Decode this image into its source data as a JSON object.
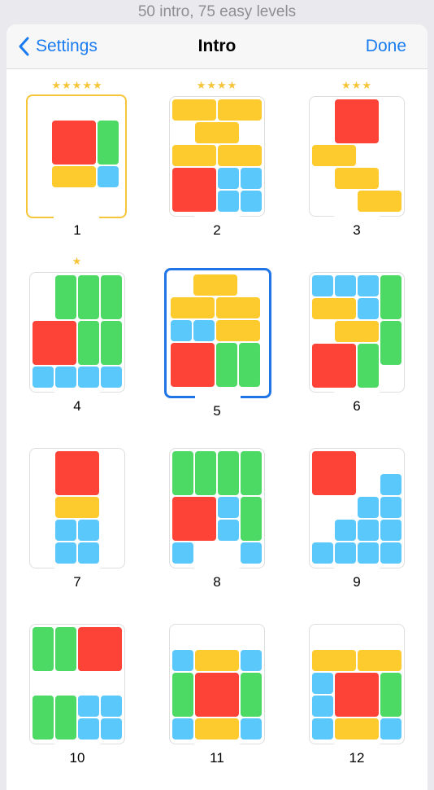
{
  "caption": "50 intro, 75 easy levels",
  "nav": {
    "back_label": "Settings",
    "title": "Intro",
    "done_label": "Done"
  },
  "icons": {
    "back": "chevron-left-icon",
    "star": "star-icon"
  },
  "colors": {
    "accent": "#1a7cf0",
    "star": "#f7c53a",
    "red": "#fd4237",
    "yellow": "#fecb2e",
    "green": "#4cd964",
    "blue": "#5ac8fa"
  },
  "levels": [
    {
      "number": "1",
      "stars": 5,
      "selected": "gold",
      "pieces": [
        {
          "c": "red",
          "x": 1,
          "y": 1,
          "w": 2,
          "h": 2
        },
        {
          "c": "green",
          "x": 3,
          "y": 1,
          "w": 1,
          "h": 2
        },
        {
          "c": "yellow",
          "x": 1,
          "y": 3,
          "w": 2,
          "h": 1
        },
        {
          "c": "blue",
          "x": 3,
          "y": 3,
          "w": 1,
          "h": 1
        }
      ]
    },
    {
      "number": "2",
      "stars": 4,
      "selected": "",
      "pieces": [
        {
          "c": "yellow",
          "x": 0,
          "y": 0,
          "w": 2,
          "h": 1
        },
        {
          "c": "yellow",
          "x": 2,
          "y": 0,
          "w": 2,
          "h": 1
        },
        {
          "c": "yellow",
          "x": 1,
          "y": 1,
          "w": 2,
          "h": 1
        },
        {
          "c": "yellow",
          "x": 0,
          "y": 2,
          "w": 2,
          "h": 1
        },
        {
          "c": "yellow",
          "x": 2,
          "y": 2,
          "w": 2,
          "h": 1
        },
        {
          "c": "red",
          "x": 0,
          "y": 3,
          "w": 2,
          "h": 2
        },
        {
          "c": "blue",
          "x": 2,
          "y": 3,
          "w": 1,
          "h": 1
        },
        {
          "c": "blue",
          "x": 3,
          "y": 3,
          "w": 1,
          "h": 1
        },
        {
          "c": "blue",
          "x": 2,
          "y": 4,
          "w": 1,
          "h": 1
        },
        {
          "c": "blue",
          "x": 3,
          "y": 4,
          "w": 1,
          "h": 1
        }
      ]
    },
    {
      "number": "3",
      "stars": 3,
      "selected": "",
      "pieces": [
        {
          "c": "red",
          "x": 1,
          "y": 0,
          "w": 2,
          "h": 2
        },
        {
          "c": "yellow",
          "x": 0,
          "y": 2,
          "w": 2,
          "h": 1
        },
        {
          "c": "yellow",
          "x": 1,
          "y": 3,
          "w": 2,
          "h": 1
        },
        {
          "c": "yellow",
          "x": 2,
          "y": 4,
          "w": 2,
          "h": 1
        }
      ]
    },
    {
      "number": "4",
      "stars": 1,
      "selected": "",
      "pieces": [
        {
          "c": "green",
          "x": 1,
          "y": 0,
          "w": 1,
          "h": 2
        },
        {
          "c": "green",
          "x": 2,
          "y": 0,
          "w": 1,
          "h": 2
        },
        {
          "c": "green",
          "x": 3,
          "y": 0,
          "w": 1,
          "h": 2
        },
        {
          "c": "red",
          "x": 0,
          "y": 2,
          "w": 2,
          "h": 2
        },
        {
          "c": "green",
          "x": 2,
          "y": 2,
          "w": 1,
          "h": 2
        },
        {
          "c": "green",
          "x": 3,
          "y": 2,
          "w": 1,
          "h": 2
        },
        {
          "c": "blue",
          "x": 0,
          "y": 4,
          "w": 1,
          "h": 1
        },
        {
          "c": "blue",
          "x": 1,
          "y": 4,
          "w": 1,
          "h": 1
        },
        {
          "c": "blue",
          "x": 2,
          "y": 4,
          "w": 1,
          "h": 1
        },
        {
          "c": "blue",
          "x": 3,
          "y": 4,
          "w": 1,
          "h": 1
        }
      ]
    },
    {
      "number": "5",
      "stars": 0,
      "selected": "blue",
      "pieces": [
        {
          "c": "yellow",
          "x": 1,
          "y": 0,
          "w": 2,
          "h": 1
        },
        {
          "c": "yellow",
          "x": 0,
          "y": 1,
          "w": 2,
          "h": 1
        },
        {
          "c": "yellow",
          "x": 2,
          "y": 1,
          "w": 2,
          "h": 1
        },
        {
          "c": "blue",
          "x": 0,
          "y": 2,
          "w": 1,
          "h": 1
        },
        {
          "c": "blue",
          "x": 1,
          "y": 2,
          "w": 1,
          "h": 1
        },
        {
          "c": "yellow",
          "x": 2,
          "y": 2,
          "w": 2,
          "h": 1
        },
        {
          "c": "red",
          "x": 0,
          "y": 3,
          "w": 2,
          "h": 2
        },
        {
          "c": "green",
          "x": 2,
          "y": 3,
          "w": 1,
          "h": 2
        },
        {
          "c": "green",
          "x": 3,
          "y": 3,
          "w": 1,
          "h": 2
        }
      ]
    },
    {
      "number": "6",
      "stars": 0,
      "selected": "",
      "pieces": [
        {
          "c": "blue",
          "x": 0,
          "y": 0,
          "w": 1,
          "h": 1
        },
        {
          "c": "blue",
          "x": 1,
          "y": 0,
          "w": 1,
          "h": 1
        },
        {
          "c": "blue",
          "x": 2,
          "y": 0,
          "w": 1,
          "h": 1
        },
        {
          "c": "green",
          "x": 3,
          "y": 0,
          "w": 1,
          "h": 2
        },
        {
          "c": "yellow",
          "x": 0,
          "y": 1,
          "w": 2,
          "h": 1
        },
        {
          "c": "blue",
          "x": 2,
          "y": 1,
          "w": 1,
          "h": 1
        },
        {
          "c": "yellow",
          "x": 1,
          "y": 2,
          "w": 2,
          "h": 1
        },
        {
          "c": "green",
          "x": 3,
          "y": 2,
          "w": 1,
          "h": 2
        },
        {
          "c": "red",
          "x": 0,
          "y": 3,
          "w": 2,
          "h": 2
        },
        {
          "c": "green",
          "x": 2,
          "y": 3,
          "w": 1,
          "h": 2
        }
      ]
    },
    {
      "number": "7",
      "stars": 0,
      "selected": "",
      "pieces": [
        {
          "c": "red",
          "x": 1,
          "y": 0,
          "w": 2,
          "h": 2
        },
        {
          "c": "yellow",
          "x": 1,
          "y": 2,
          "w": 2,
          "h": 1
        },
        {
          "c": "blue",
          "x": 1,
          "y": 3,
          "w": 1,
          "h": 1
        },
        {
          "c": "blue",
          "x": 2,
          "y": 3,
          "w": 1,
          "h": 1
        },
        {
          "c": "blue",
          "x": 1,
          "y": 4,
          "w": 1,
          "h": 1
        },
        {
          "c": "blue",
          "x": 2,
          "y": 4,
          "w": 1,
          "h": 1
        }
      ]
    },
    {
      "number": "8",
      "stars": 0,
      "selected": "",
      "pieces": [
        {
          "c": "green",
          "x": 0,
          "y": 0,
          "w": 1,
          "h": 2
        },
        {
          "c": "green",
          "x": 1,
          "y": 0,
          "w": 1,
          "h": 2
        },
        {
          "c": "green",
          "x": 2,
          "y": 0,
          "w": 1,
          "h": 2
        },
        {
          "c": "green",
          "x": 3,
          "y": 0,
          "w": 1,
          "h": 2
        },
        {
          "c": "red",
          "x": 0,
          "y": 2,
          "w": 2,
          "h": 2
        },
        {
          "c": "blue",
          "x": 2,
          "y": 2,
          "w": 1,
          "h": 1
        },
        {
          "c": "green",
          "x": 3,
          "y": 2,
          "w": 1,
          "h": 2
        },
        {
          "c": "blue",
          "x": 2,
          "y": 3,
          "w": 1,
          "h": 1
        },
        {
          "c": "blue",
          "x": 0,
          "y": 4,
          "w": 1,
          "h": 1
        },
        {
          "c": "blue",
          "x": 3,
          "y": 4,
          "w": 1,
          "h": 1
        }
      ]
    },
    {
      "number": "9",
      "stars": 0,
      "selected": "",
      "pieces": [
        {
          "c": "red",
          "x": 0,
          "y": 0,
          "w": 2,
          "h": 2
        },
        {
          "c": "blue",
          "x": 3,
          "y": 1,
          "w": 1,
          "h": 1
        },
        {
          "c": "blue",
          "x": 2,
          "y": 2,
          "w": 1,
          "h": 1
        },
        {
          "c": "blue",
          "x": 3,
          "y": 2,
          "w": 1,
          "h": 1
        },
        {
          "c": "blue",
          "x": 1,
          "y": 3,
          "w": 1,
          "h": 1
        },
        {
          "c": "blue",
          "x": 2,
          "y": 3,
          "w": 1,
          "h": 1
        },
        {
          "c": "blue",
          "x": 3,
          "y": 3,
          "w": 1,
          "h": 1
        },
        {
          "c": "blue",
          "x": 0,
          "y": 4,
          "w": 1,
          "h": 1
        },
        {
          "c": "blue",
          "x": 1,
          "y": 4,
          "w": 1,
          "h": 1
        },
        {
          "c": "blue",
          "x": 2,
          "y": 4,
          "w": 1,
          "h": 1
        },
        {
          "c": "blue",
          "x": 3,
          "y": 4,
          "w": 1,
          "h": 1
        }
      ]
    },
    {
      "number": "10",
      "stars": 0,
      "selected": "",
      "pieces": [
        {
          "c": "green",
          "x": 0,
          "y": 0,
          "w": 1,
          "h": 2
        },
        {
          "c": "green",
          "x": 1,
          "y": 0,
          "w": 1,
          "h": 2
        },
        {
          "c": "red",
          "x": 2,
          "y": 0,
          "w": 2,
          "h": 2
        },
        {
          "c": "green",
          "x": 0,
          "y": 3,
          "w": 1,
          "h": 2
        },
        {
          "c": "green",
          "x": 1,
          "y": 3,
          "w": 1,
          "h": 2
        },
        {
          "c": "blue",
          "x": 2,
          "y": 3,
          "w": 1,
          "h": 1
        },
        {
          "c": "blue",
          "x": 3,
          "y": 3,
          "w": 1,
          "h": 1
        },
        {
          "c": "blue",
          "x": 2,
          "y": 4,
          "w": 1,
          "h": 1
        },
        {
          "c": "blue",
          "x": 3,
          "y": 4,
          "w": 1,
          "h": 1
        }
      ]
    },
    {
      "number": "11",
      "stars": 0,
      "selected": "",
      "pieces": [
        {
          "c": "blue",
          "x": 0,
          "y": 1,
          "w": 1,
          "h": 1
        },
        {
          "c": "yellow",
          "x": 1,
          "y": 1,
          "w": 2,
          "h": 1
        },
        {
          "c": "blue",
          "x": 3,
          "y": 1,
          "w": 1,
          "h": 1
        },
        {
          "c": "green",
          "x": 0,
          "y": 2,
          "w": 1,
          "h": 2
        },
        {
          "c": "red",
          "x": 1,
          "y": 2,
          "w": 2,
          "h": 2
        },
        {
          "c": "green",
          "x": 3,
          "y": 2,
          "w": 1,
          "h": 2
        },
        {
          "c": "blue",
          "x": 0,
          "y": 4,
          "w": 1,
          "h": 1
        },
        {
          "c": "yellow",
          "x": 1,
          "y": 4,
          "w": 2,
          "h": 1
        },
        {
          "c": "blue",
          "x": 3,
          "y": 4,
          "w": 1,
          "h": 1
        }
      ]
    },
    {
      "number": "12",
      "stars": 0,
      "selected": "",
      "pieces": [
        {
          "c": "yellow",
          "x": 0,
          "y": 1,
          "w": 2,
          "h": 1
        },
        {
          "c": "yellow",
          "x": 2,
          "y": 1,
          "w": 2,
          "h": 1
        },
        {
          "c": "blue",
          "x": 0,
          "y": 2,
          "w": 1,
          "h": 1
        },
        {
          "c": "red",
          "x": 1,
          "y": 2,
          "w": 2,
          "h": 2
        },
        {
          "c": "green",
          "x": 3,
          "y": 2,
          "w": 1,
          "h": 2
        },
        {
          "c": "blue",
          "x": 0,
          "y": 3,
          "w": 1,
          "h": 1
        },
        {
          "c": "blue",
          "x": 0,
          "y": 4,
          "w": 1,
          "h": 1
        },
        {
          "c": "yellow",
          "x": 1,
          "y": 4,
          "w": 2,
          "h": 1
        },
        {
          "c": "blue",
          "x": 3,
          "y": 4,
          "w": 1,
          "h": 1
        }
      ]
    }
  ]
}
